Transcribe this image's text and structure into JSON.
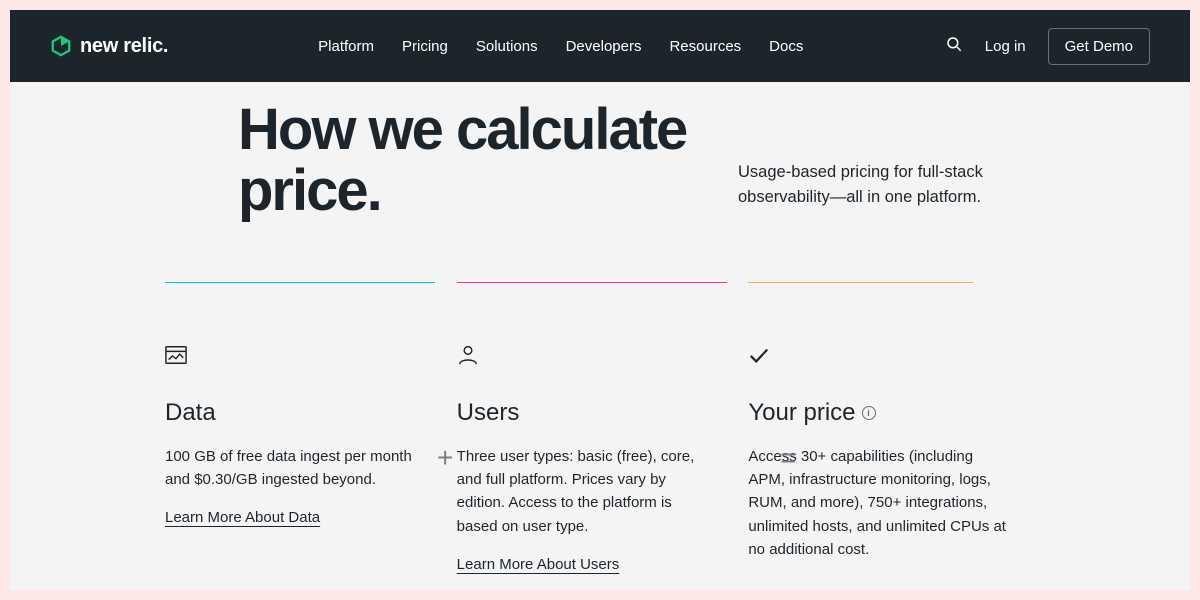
{
  "brand": {
    "name": "new relic."
  },
  "nav": {
    "links": [
      "Platform",
      "Pricing",
      "Solutions",
      "Developers",
      "Resources",
      "Docs"
    ],
    "login": "Log in",
    "demo": "Get Demo"
  },
  "hero": {
    "title": "How we calculate price.",
    "subtitle": "Usage-based pricing for full-stack observability—all in one platform."
  },
  "columns": {
    "data": {
      "title": "Data",
      "body": "100 GB of free data ingest per month and $0.30/GB ingested beyond.",
      "link": "Learn More About Data"
    },
    "users": {
      "title": "Users",
      "body": "Three user types: basic (free), core, and full platform. Prices vary by edition. Access to the platform is based on user type.",
      "link": "Learn More About Users"
    },
    "price": {
      "title": "Your price",
      "body": "Access 30+ capabilities (including APM, infrastructure monitoring, logs, RUM, and more), 750+ integrations, unlimited hosts, and unlimited CPUs at no additional cost."
    }
  },
  "operators": {
    "plus": "+",
    "eq": "="
  }
}
